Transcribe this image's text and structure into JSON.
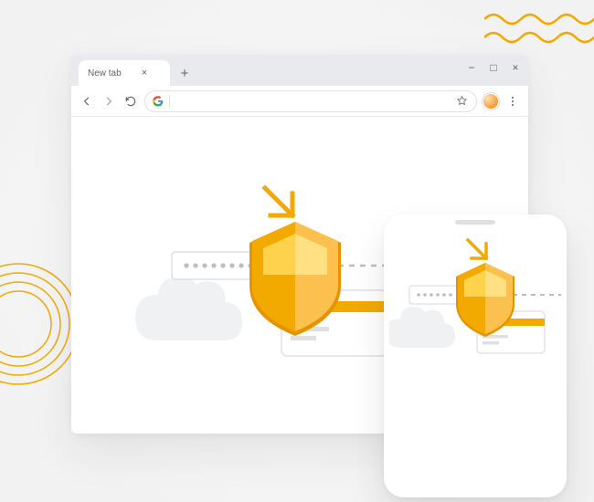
{
  "browser": {
    "tab_title": "New tab",
    "window_controls": {
      "minimize": "−",
      "maximize": "□",
      "close": "×"
    },
    "tab_close": "×",
    "new_tab": "+",
    "omnibox_value": "",
    "omnibox_placeholder": ""
  },
  "illustration": {
    "name": "security-shield-illustration",
    "icons": [
      "arrow-down-right-icon",
      "shield-icon",
      "credit-card-icon",
      "cloud-icon",
      "password-dots-icon"
    ],
    "colors": {
      "shield_primary": "#F2A900",
      "shield_light": "#FBC04D",
      "shield_face": "#FFE082",
      "card_stripe": "#F2A900",
      "cloud": "#F0F1F3",
      "dash": "#BDBDBD"
    }
  }
}
